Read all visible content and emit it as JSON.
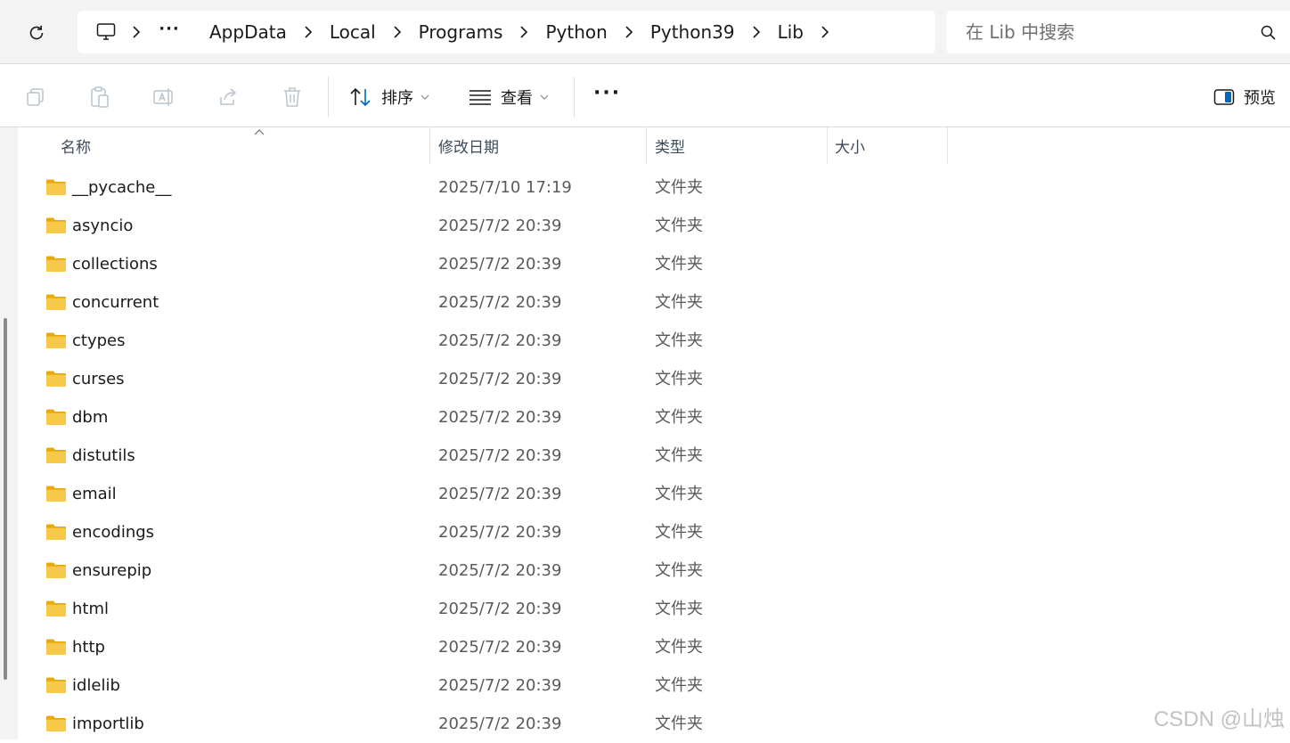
{
  "address": {
    "breadcrumbs": [
      "AppData",
      "Local",
      "Programs",
      "Python",
      "Python39",
      "Lib"
    ],
    "more_glyph": "···"
  },
  "search": {
    "placeholder": "在 Lib 中搜索"
  },
  "toolbar": {
    "sort_label": "排序",
    "view_label": "查看",
    "more_glyph": "···",
    "preview_label": "预览"
  },
  "columns": {
    "name": "名称",
    "modified": "修改日期",
    "type": "类型",
    "size": "大小"
  },
  "files": [
    {
      "name": "__pycache__",
      "modified": "2025/7/10 17:19",
      "type": "文件夹"
    },
    {
      "name": "asyncio",
      "modified": "2025/7/2 20:39",
      "type": "文件夹"
    },
    {
      "name": "collections",
      "modified": "2025/7/2 20:39",
      "type": "文件夹"
    },
    {
      "name": "concurrent",
      "modified": "2025/7/2 20:39",
      "type": "文件夹"
    },
    {
      "name": "ctypes",
      "modified": "2025/7/2 20:39",
      "type": "文件夹"
    },
    {
      "name": "curses",
      "modified": "2025/7/2 20:39",
      "type": "文件夹"
    },
    {
      "name": "dbm",
      "modified": "2025/7/2 20:39",
      "type": "文件夹"
    },
    {
      "name": "distutils",
      "modified": "2025/7/2 20:39",
      "type": "文件夹"
    },
    {
      "name": "email",
      "modified": "2025/7/2 20:39",
      "type": "文件夹"
    },
    {
      "name": "encodings",
      "modified": "2025/7/2 20:39",
      "type": "文件夹"
    },
    {
      "name": "ensurepip",
      "modified": "2025/7/2 20:39",
      "type": "文件夹"
    },
    {
      "name": "html",
      "modified": "2025/7/2 20:39",
      "type": "文件夹"
    },
    {
      "name": "http",
      "modified": "2025/7/2 20:39",
      "type": "文件夹"
    },
    {
      "name": "idlelib",
      "modified": "2025/7/2 20:39",
      "type": "文件夹"
    },
    {
      "name": "importlib",
      "modified": "2025/7/2 20:39",
      "type": "文件夹"
    }
  ],
  "watermark": "CSDN @山烛",
  "colors": {
    "folder_body": "#f7c948",
    "folder_back": "#e8a90f",
    "accent": "#0067c0"
  }
}
